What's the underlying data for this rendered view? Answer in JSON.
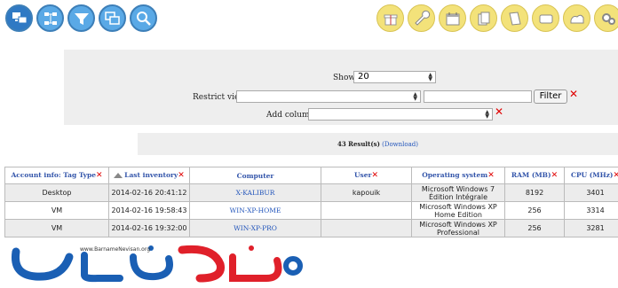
{
  "toolbar_left": {
    "icons": [
      "computers-icon",
      "network-icon",
      "filter-funnel-icon",
      "windows-stack-icon",
      "search-magnifier-icon"
    ],
    "color_active": "#2f79c4",
    "color": "#5aa9e6"
  },
  "toolbar_right": {
    "icons": [
      "gift-icon",
      "wrench-icon",
      "calendar-icon",
      "documents-icon",
      "book-icon",
      "card-icon",
      "network-config-icon",
      "gears-icon"
    ],
    "color": "#f3e27a"
  },
  "filters": {
    "show_label": "Show:",
    "show_value": "20",
    "restrict_label": "Restrict view:",
    "restrict_value": "",
    "restrict_text": "",
    "filter_button": "Filter",
    "add_column_label": "Add column:",
    "add_column_value": ""
  },
  "results": {
    "count_text": "43 Result(s)",
    "download_text": "(Download)"
  },
  "table": {
    "columns": [
      {
        "label": "Account info: Tag Type",
        "removable": true
      },
      {
        "label": "Last inventory",
        "removable": true,
        "sorted": true
      },
      {
        "label": "Computer",
        "removable": false
      },
      {
        "label": "User",
        "removable": true
      },
      {
        "label": "Operating system",
        "removable": true
      },
      {
        "label": "RAM (MB)",
        "removable": true
      },
      {
        "label": "CPU (MHz)",
        "removable": true
      }
    ],
    "rows": [
      {
        "tag": "Desktop",
        "last_inventory": "2014-02-16 20:41:12",
        "computer": "X-KALIBUR",
        "user": "kapouik",
        "os": "Microsoft Windows 7 Édition Intégrale",
        "ram": "8192",
        "cpu": "3401"
      },
      {
        "tag": "VM",
        "last_inventory": "2014-02-16 19:58:43",
        "computer": "WIN-XP-HOME",
        "user": "",
        "os": "Microsoft Windows XP Home Edition",
        "ram": "256",
        "cpu": "3314"
      },
      {
        "tag": "VM",
        "last_inventory": "2014-02-16 19:32:00",
        "computer": "WIN-XP-PRO",
        "user": "",
        "os": "Microsoft Windows XP Professional",
        "ram": "256",
        "cpu": "3281"
      }
    ]
  },
  "watermark": {
    "url": "www.BarnameNevisan.org",
    "color": "#1a5fb4",
    "accent": "#e0202a"
  }
}
